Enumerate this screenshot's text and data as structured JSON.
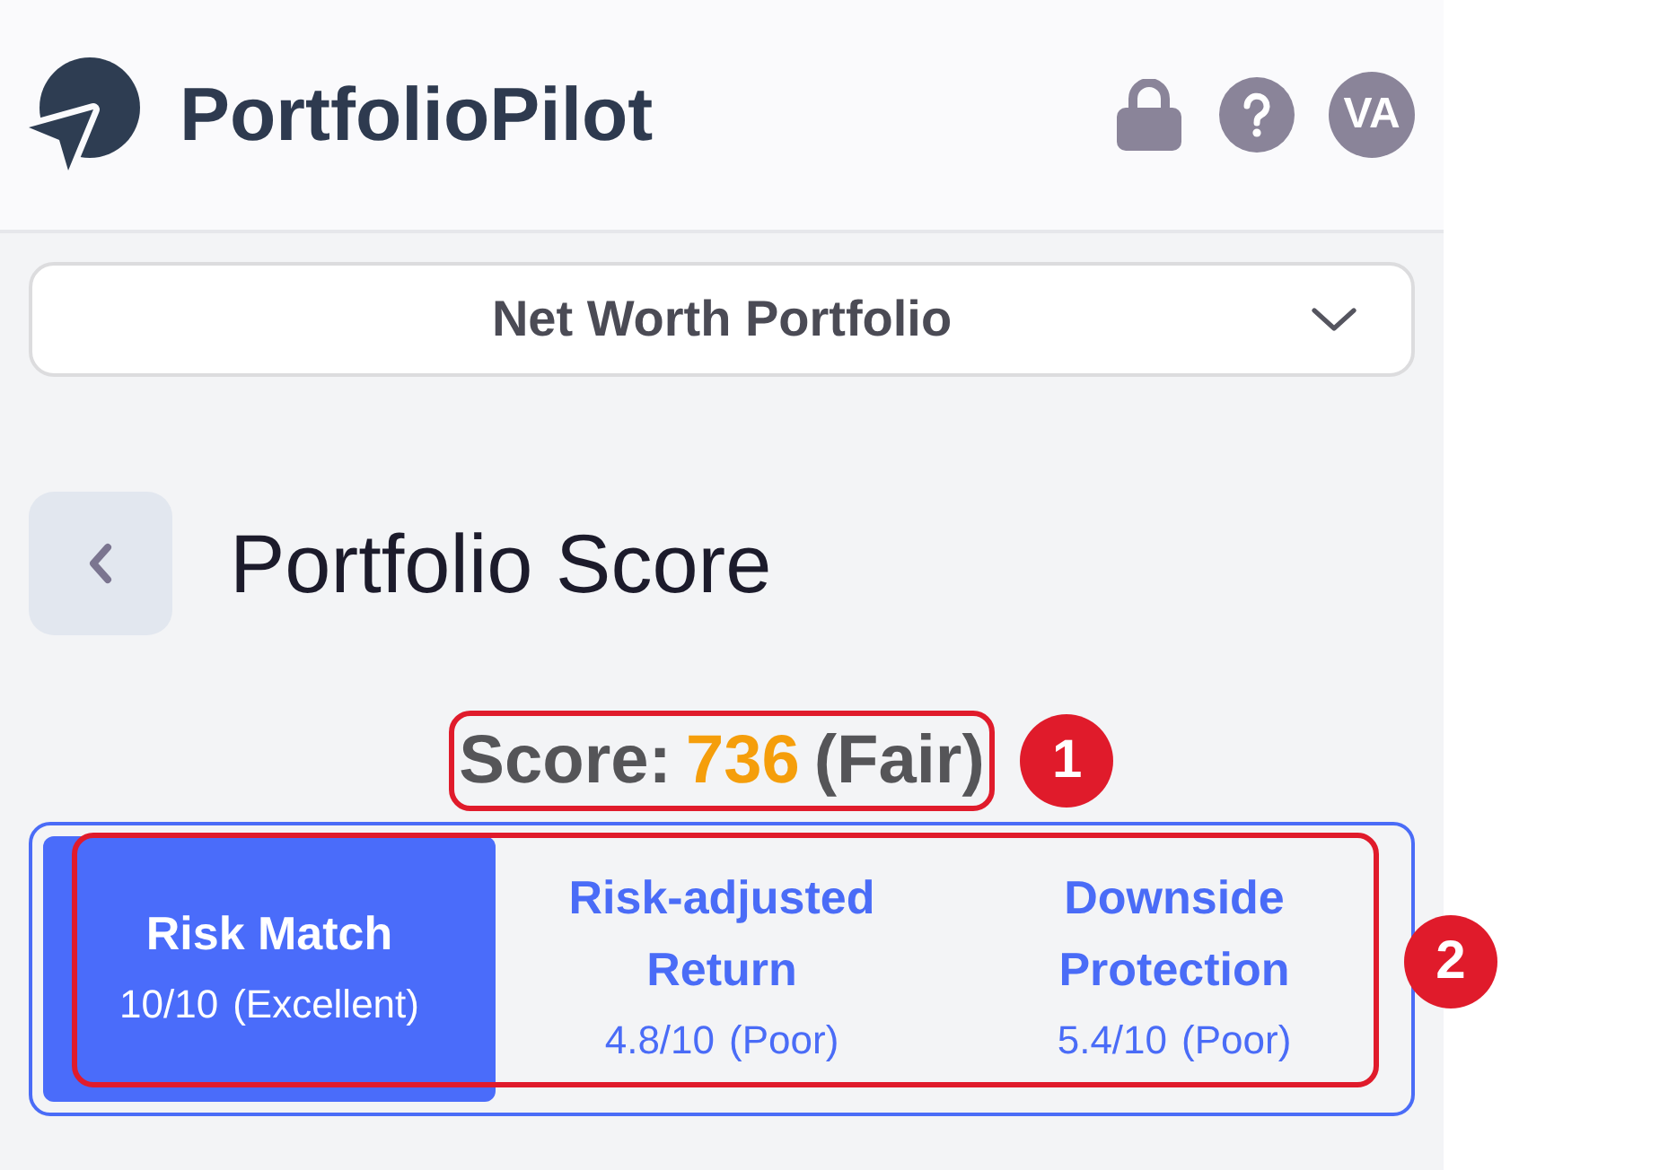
{
  "header": {
    "brand": "PortfolioPilot",
    "avatar_initials": "VA"
  },
  "portfolio_selector": {
    "value": "Net Worth Portfolio"
  },
  "page": {
    "title": "Portfolio Score"
  },
  "score": {
    "label": "Score:",
    "value": "736",
    "rating": "(Fair)",
    "annotation": "1"
  },
  "categories": {
    "annotation": "2",
    "tabs": [
      {
        "title": "Risk Match",
        "score": "10/10",
        "rating": "(Excellent)",
        "selected": true
      },
      {
        "title": "Risk-adjusted Return",
        "score": "4.8/10",
        "rating": "(Poor)",
        "selected": false
      },
      {
        "title": "Downside Protection",
        "score": "5.4/10",
        "rating": "(Poor)",
        "selected": false
      }
    ]
  }
}
